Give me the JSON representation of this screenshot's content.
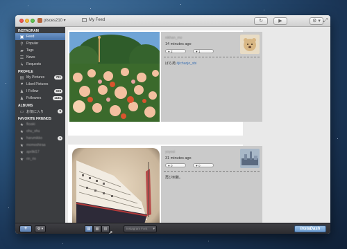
{
  "toolbar": {
    "account": "pisces210 ▾",
    "title": "My Feed",
    "refresh_icon": "↻",
    "play_icon": "▶",
    "gear_icon": "⚙ ▾",
    "fullscreen_icon": "⤢"
  },
  "sidebar": {
    "instagram_header": "INSTAGRAM",
    "instagram_items": [
      {
        "label": "Feed",
        "icon": "feed-icon",
        "glyph": "▣"
      },
      {
        "label": "Popular",
        "icon": "pin-icon",
        "glyph": "⚲"
      },
      {
        "label": "Tags",
        "icon": "tag-icon",
        "glyph": "▰"
      },
      {
        "label": "News",
        "icon": "news-icon",
        "glyph": "☰"
      },
      {
        "label": "Requests",
        "icon": "requests-icon",
        "glyph": "↳"
      }
    ],
    "profile_header": "PROFILE",
    "profile_items": [
      {
        "label": "My Pictures",
        "icon": "pictures-icon",
        "glyph": "▤",
        "badge": "781"
      },
      {
        "label": "Liked Pictures",
        "icon": "heart-icon",
        "glyph": "♥",
        "badge": ""
      },
      {
        "label": "I Follow",
        "icon": "person-icon",
        "glyph": "♟",
        "badge": "698"
      },
      {
        "label": "Followers",
        "icon": "people-icon",
        "glyph": "♟",
        "badge": "1181"
      }
    ],
    "albums_header": "ALBUMS",
    "album_items": [
      {
        "label": "お気に入り",
        "icon": "album-icon",
        "glyph": "▭",
        "badge": "5"
      }
    ],
    "friends_header": "FAVORITE FRIENDS",
    "friend_items": [
      {
        "label": "fksaki",
        "badge": ""
      },
      {
        "label": "ohu_ohu",
        "badge": ""
      },
      {
        "label": "harumikko",
        "badge": "1"
      },
      {
        "label": "momoshiraa",
        "badge": ""
      },
      {
        "label": "aprilkl17",
        "badge": ""
      },
      {
        "label": "rin_rio",
        "badge": ""
      }
    ]
  },
  "feed": {
    "posts": [
      {
        "username": "nikhan_mo",
        "time": "14 minutes ago",
        "comments": "2",
        "likes": "1",
        "caption": "ばら苑",
        "tag": "#jichanjo_sbi"
      },
      {
        "username": "yoyosi",
        "time": "31 minutes ago",
        "comments": "0",
        "likes": "0",
        "caption": "再び到着。",
        "tag": ""
      }
    ]
  },
  "bottombar": {
    "add_label": "+",
    "menu_label": "⚙ ▾",
    "view_modes": [
      "▤",
      "▦",
      "▥"
    ],
    "filter_select": "Instagram Font",
    "brand": "InstaDash"
  }
}
